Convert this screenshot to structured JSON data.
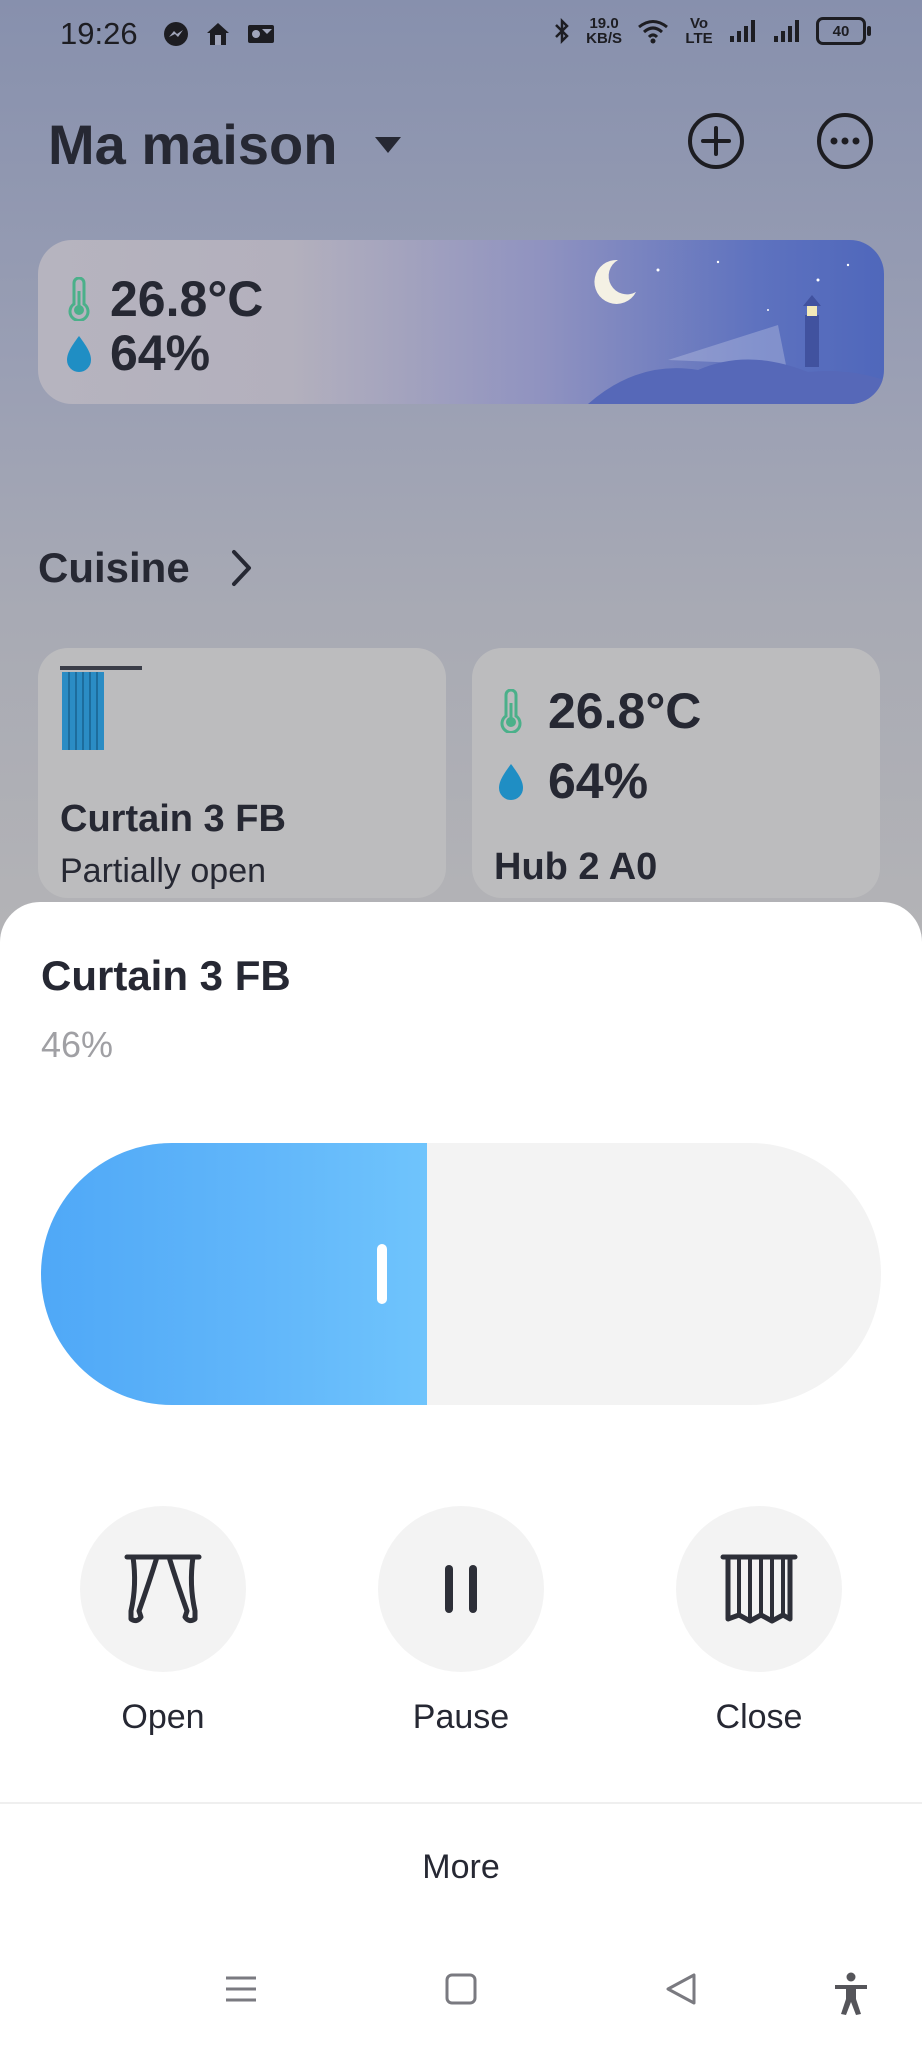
{
  "status_bar": {
    "time": "19:26",
    "speed_value": "19.0",
    "speed_unit": "KB/S",
    "volte": "Vo LTE",
    "battery": "40"
  },
  "header": {
    "home_name": "Ma maison"
  },
  "weather": {
    "temperature": "26.8°C",
    "humidity": "64%"
  },
  "room": {
    "title": "Cuisine"
  },
  "devices": [
    {
      "name": "Curtain 3 FB",
      "status": "Partially open"
    },
    {
      "name": "Hub 2 A0",
      "temperature": "26.8°C",
      "humidity": "64%"
    }
  ],
  "sheet": {
    "title": "Curtain 3 FB",
    "percent": "46%",
    "position_fraction": 0.46,
    "buttons": {
      "open": "Open",
      "pause": "Pause",
      "close": "Close"
    },
    "more": "More"
  },
  "colors": {
    "slider_fill": "#4fa8f7",
    "slider_track": "#f3f3f3",
    "thermo_green": "#4bb08a",
    "drop_blue": "#1f8ec4",
    "text_dark": "#262833"
  }
}
